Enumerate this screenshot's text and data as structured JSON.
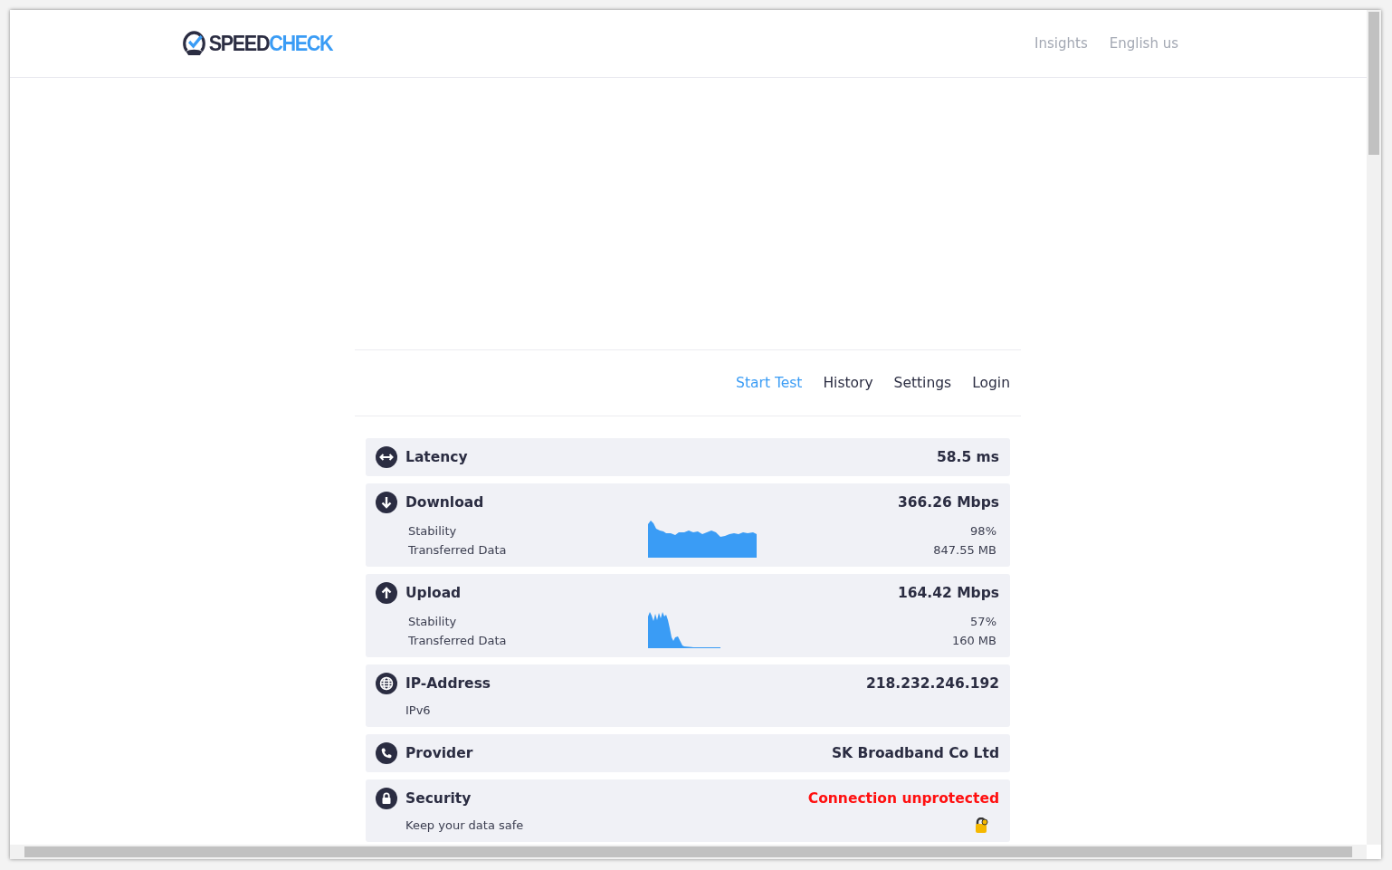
{
  "header": {
    "logo": {
      "part_1": "SPEED",
      "part_2": "CHECK"
    },
    "links": [
      "Insights",
      "English us"
    ]
  },
  "nav": [
    {
      "label": "Start Test",
      "selected": true
    },
    {
      "label": "History",
      "selected": false
    },
    {
      "label": "Settings",
      "selected": false
    },
    {
      "label": "Login",
      "selected": false
    }
  ],
  "results": [
    {
      "kind": "simple",
      "title": "Latency",
      "value": "58.5 ms"
    },
    {
      "kind": "speed",
      "title": "Download",
      "value": "366.26 Mbps",
      "rows": [
        {
          "label": "Stability",
          "value": "98%"
        },
        {
          "label": "Transferred Data",
          "value": "847.55 MB"
        }
      ]
    },
    {
      "kind": "speed",
      "title": "Upload",
      "value": "164.42 Mbps",
      "rows": [
        {
          "label": "Stability",
          "value": "57%"
        },
        {
          "label": "Transferred Data",
          "value": "160 MB"
        }
      ]
    },
    {
      "kind": "note",
      "title": "IP-Address",
      "value": "218.232.246.192",
      "note": "IPv6"
    },
    {
      "kind": "simple",
      "title": "Provider",
      "value": "SK Broadband Co Ltd"
    },
    {
      "kind": "note",
      "title": "Security",
      "value": "Connection unprotected",
      "alert": true,
      "note": "Keep your data safe"
    }
  ]
}
